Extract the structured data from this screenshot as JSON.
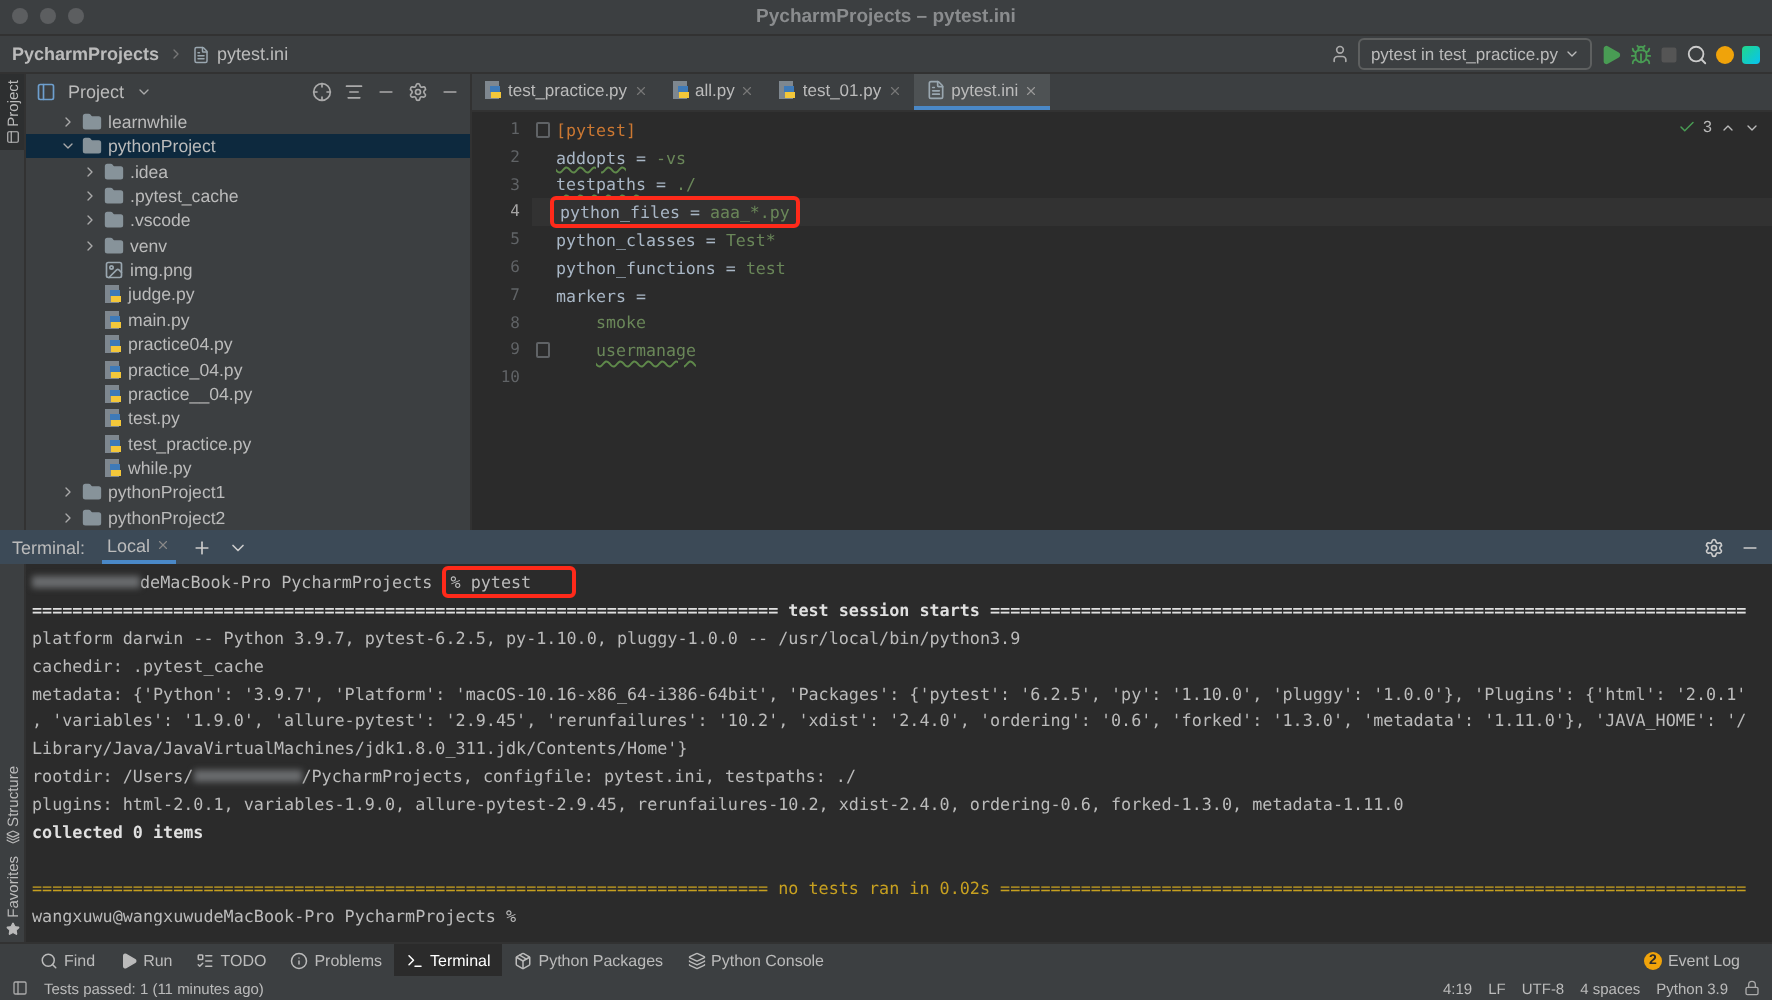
{
  "window": {
    "title": "PycharmProjects – pytest.ini"
  },
  "breadcrumbs": [
    {
      "label": "PycharmProjects"
    },
    {
      "label": "pytest.ini"
    }
  ],
  "toolbar": {
    "run_config": "pytest in test_practice.py"
  },
  "left_stripe": {
    "top": [
      {
        "label": "Project",
        "selected": true
      }
    ],
    "bottom": [
      {
        "label": "Structure",
        "selected": false
      },
      {
        "label": "Favorites",
        "selected": false
      }
    ]
  },
  "project_panel": {
    "title": "Project",
    "tree": [
      {
        "label": "learnwhile",
        "kind": "folder",
        "expanded": false,
        "selected": false
      },
      {
        "label": "pythonProject",
        "kind": "folder",
        "expanded": true,
        "selected": true,
        "children": [
          {
            "label": ".idea",
            "kind": "folder",
            "expanded": false,
            "selected": false
          },
          {
            "label": ".pytest_cache",
            "kind": "folder",
            "expanded": false,
            "selected": false
          },
          {
            "label": ".vscode",
            "kind": "folder",
            "expanded": false,
            "selected": false
          },
          {
            "label": "venv",
            "kind": "folder",
            "expanded": false,
            "selected": false
          },
          {
            "label": "img.png",
            "kind": "image",
            "selected": false
          },
          {
            "label": "judge.py",
            "kind": "python",
            "selected": false
          },
          {
            "label": "main.py",
            "kind": "python",
            "selected": false
          },
          {
            "label": "practice04.py",
            "kind": "python",
            "selected": false
          },
          {
            "label": "practice_04.py",
            "kind": "python",
            "selected": false
          },
          {
            "label": "practice__04.py",
            "kind": "python",
            "selected": false
          },
          {
            "label": "test.py",
            "kind": "python",
            "selected": false
          },
          {
            "label": "test_practice.py",
            "kind": "python",
            "selected": false
          },
          {
            "label": "while.py",
            "kind": "python",
            "selected": false
          }
        ]
      },
      {
        "label": "pythonProject1",
        "kind": "folder",
        "expanded": false,
        "selected": false
      },
      {
        "label": "pythonProject2",
        "kind": "folder",
        "expanded": false,
        "selected": false
      }
    ]
  },
  "editor_tabs": [
    {
      "label": "test_practice.py",
      "kind": "python",
      "selected": false
    },
    {
      "label": "all.py",
      "kind": "python",
      "selected": false
    },
    {
      "label": "test_01.py",
      "kind": "python",
      "selected": false
    },
    {
      "label": "pytest.ini",
      "kind": "ini",
      "selected": true
    }
  ],
  "editor": {
    "inspection_count": "3",
    "lines": [
      {
        "number": "1",
        "fold": true,
        "tokens": [
          {
            "kind": "section",
            "text": "[pytest]"
          }
        ]
      },
      {
        "number": "2",
        "tokens": [
          {
            "kind": "key",
            "text": "addopts",
            "typo": true
          },
          {
            "kind": "sign",
            "text": " = "
          },
          {
            "kind": "value",
            "text": "-vs"
          }
        ]
      },
      {
        "number": "3",
        "tokens": [
          {
            "kind": "key",
            "text": "testpaths",
            "typo": true
          },
          {
            "kind": "sign",
            "text": " = "
          },
          {
            "kind": "value",
            "text": "./"
          }
        ]
      },
      {
        "number": "4",
        "highlighted": true,
        "tokens": [
          {
            "kind": "key",
            "text": "python_files"
          },
          {
            "kind": "sign",
            "text": " = "
          },
          {
            "kind": "value",
            "text": "aaa_*.py"
          }
        ]
      },
      {
        "number": "5",
        "tokens": [
          {
            "kind": "key",
            "text": "python_classes"
          },
          {
            "kind": "sign",
            "text": " = "
          },
          {
            "kind": "value",
            "text": "Test*"
          }
        ]
      },
      {
        "number": "6",
        "tokens": [
          {
            "kind": "key",
            "text": "python_functions"
          },
          {
            "kind": "sign",
            "text": " = "
          },
          {
            "kind": "value",
            "text": "test"
          }
        ]
      },
      {
        "number": "7",
        "tokens": [
          {
            "kind": "key",
            "text": "markers"
          },
          {
            "kind": "sign",
            "text": " ="
          }
        ]
      },
      {
        "number": "8",
        "indent": true,
        "tokens": [
          {
            "kind": "value",
            "text": "smoke"
          }
        ]
      },
      {
        "number": "9",
        "indent": true,
        "fold": true,
        "tokens": [
          {
            "kind": "value",
            "text": "usermanage",
            "typo": true
          }
        ]
      },
      {
        "number": "10"
      }
    ]
  },
  "terminal": {
    "title": "Terminal:",
    "tabs": [
      {
        "label": "Local",
        "selected": true
      }
    ],
    "lines": [
      {
        "kind": "plain",
        "parts": [
          {
            "kind": "redacted"
          },
          {
            "text": "deMacBook-Pro PycharmProjects "
          },
          {
            "text": "% pytest",
            "highlighted": true
          }
        ]
      },
      {
        "kind": "bold",
        "parts": [
          {
            "text": "========================================================================== test session starts ==========================================================================="
          }
        ]
      },
      {
        "kind": "plain",
        "parts": [
          {
            "text": "platform darwin -- Python 3.9.7, pytest-6.2.5, py-1.10.0, pluggy-1.0.0 -- /usr/local/bin/python3.9"
          }
        ]
      },
      {
        "kind": "plain",
        "parts": [
          {
            "text": "cachedir: .pytest_cache"
          }
        ]
      },
      {
        "kind": "plain",
        "parts": [
          {
            "text": "metadata: {'Python': '3.9.7', 'Platform': 'macOS-10.16-x86_64-i386-64bit', 'Packages': {'pytest': '6.2.5', 'py': '1.10.0', 'pluggy': '1.0.0'}, 'Plugins': {'html': '2.0.1'"
          }
        ]
      },
      {
        "kind": "plain",
        "parts": [
          {
            "text": ", 'variables': '1.9.0', 'allure-pytest': '2.9.45', 'rerunfailures': '10.2', 'xdist': '2.4.0', 'ordering': '0.6', 'forked': '1.3.0', 'metadata': '1.11.0'}, 'JAVA_HOME': '/"
          }
        ]
      },
      {
        "kind": "plain",
        "parts": [
          {
            "text": "Library/Java/JavaVirtualMachines/jdk1.8.0_311.jdk/Contents/Home'}"
          }
        ]
      },
      {
        "kind": "plain",
        "parts": [
          {
            "text": "rootdir: /Users/"
          },
          {
            "kind": "redacted"
          },
          {
            "text": "/PycharmProjects, configfile: pytest.ini, testpaths: ./"
          }
        ]
      },
      {
        "kind": "plain",
        "parts": [
          {
            "text": "plugins: html-2.0.1, variables-1.9.0, allure-pytest-2.9.45, rerunfailures-10.2, xdist-2.4.0, ordering-0.6, forked-1.3.0, metadata-1.11.0"
          }
        ]
      },
      {
        "kind": "bold",
        "parts": [
          {
            "text": "collected 0 items"
          }
        ]
      },
      {
        "kind": "blank"
      },
      {
        "kind": "warning",
        "parts": [
          {
            "text": "========================================================================= no tests ran in 0.02s =========================================================================="
          }
        ]
      },
      {
        "kind": "plain",
        "parts": [
          {
            "text": "wangxuwu@wangxuwudeMacBook-Pro PycharmProjects %"
          }
        ]
      }
    ]
  },
  "tool_windows": [
    {
      "label": "Find",
      "kind": "find",
      "selected": false
    },
    {
      "label": "Run",
      "kind": "run",
      "selected": false
    },
    {
      "label": "TODO",
      "kind": "todo",
      "selected": false
    },
    {
      "label": "Problems",
      "kind": "problems",
      "selected": false
    },
    {
      "label": "Terminal",
      "kind": "terminal",
      "selected": true
    },
    {
      "label": "Python Packages",
      "kind": "packages",
      "selected": false
    },
    {
      "label": "Python Console",
      "kind": "console",
      "selected": false
    }
  ],
  "event_log": {
    "label": "Event Log",
    "count": "2"
  },
  "status_bar": {
    "message": "Tests passed: 1 (11 minutes ago)",
    "items": [
      "4:19",
      "LF",
      "UTF-8",
      "4 spaces",
      "Python 3.9"
    ]
  }
}
